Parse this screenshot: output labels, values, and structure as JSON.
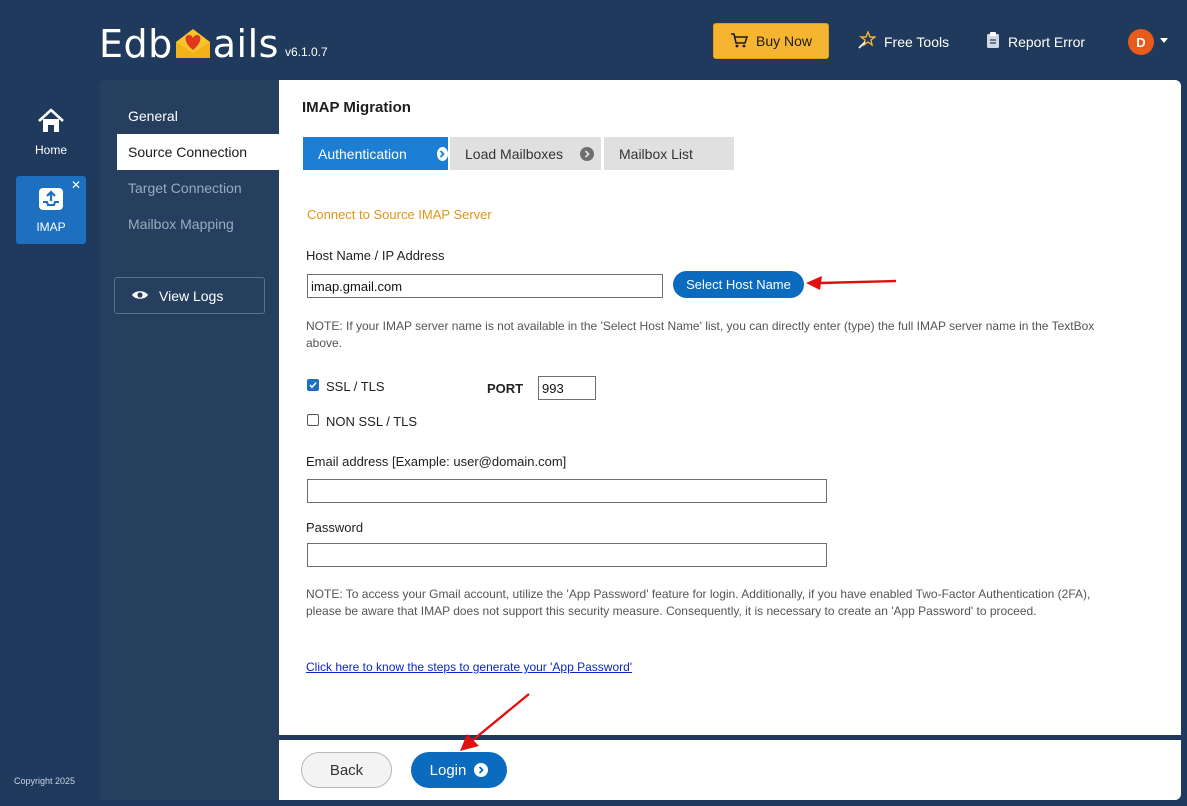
{
  "header": {
    "logo_text_left": "Edb",
    "logo_text_right": "ails",
    "version": "v6.1.0.7",
    "buy_now": "Buy Now",
    "free_tools": "Free Tools",
    "report_error": "Report Error",
    "avatar_initial": "D"
  },
  "rail": {
    "home_label": "Home",
    "imap_label": "IMAP",
    "close_glyph": "✕",
    "copyright": "Copyright 2025"
  },
  "sidenav": {
    "items": [
      {
        "label": "General"
      },
      {
        "label": "Source Connection"
      },
      {
        "label": "Target Connection"
      },
      {
        "label": "Mailbox Mapping"
      }
    ],
    "view_logs": "View Logs"
  },
  "main": {
    "title": "IMAP Migration",
    "tabs": [
      {
        "label": "Authentication"
      },
      {
        "label": "Load Mailboxes"
      },
      {
        "label": "Mailbox List"
      }
    ],
    "section_heading": "Connect to Source IMAP Server",
    "host_label": "Host Name / IP Address",
    "host_value": "imap.gmail.com",
    "select_host_button": "Select Host Name",
    "host_note": "NOTE: If your IMAP server name is not available in the 'Select Host Name' list, you can directly enter (type) the full IMAP server name in the TextBox above.",
    "ssl_label": "SSL / TLS",
    "ssl_checked": true,
    "non_ssl_label": "NON SSL / TLS",
    "non_ssl_checked": false,
    "port_label": "PORT",
    "port_value": "993",
    "email_label": "Email address [Example: user@domain.com]",
    "email_value": "",
    "password_label": "Password",
    "password_value": "",
    "gmail_note": "NOTE: To access your Gmail account, utilize the 'App Password' feature for login. Additionally, if you have enabled Two-Factor Authentication (2FA), please be aware that IMAP does not support this security measure. Consequently, it is necessary to create an 'App Password' to proceed.",
    "app_password_link": "Click here to know the steps to generate your 'App Password'"
  },
  "footer": {
    "back_label": "Back",
    "login_label": "Login"
  },
  "colors": {
    "background": "#1f3a5c",
    "accent_blue": "#1d7fd4",
    "buy_yellow": "#f6b530",
    "section_orange": "#e09514",
    "annotation_red": "#e01010"
  }
}
